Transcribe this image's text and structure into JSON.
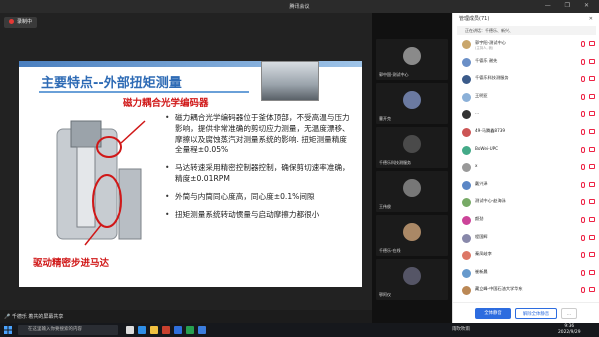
{
  "window": {
    "title": "腾讯会议",
    "controls": "— ❐ ✕"
  },
  "recording": {
    "label": "录制中"
  },
  "slide": {
    "title": "主要特点--外部扭矩测量",
    "callout_top": "磁力耦合光学编码器",
    "callout_bottom": "驱动精密步进马达",
    "bullets": [
      "磁力耦合光学编码器位于釜体顶部，不受高温与压力影响，提供非常准确的剪切应力测量，无温度漂移、摩擦以及腐蚀蒸汽对测量系统的影响. 扭矩测量精度全量程±0.05%",
      "马达转速采用精密控制器控制，确保剪切速率准确，精度±0.01RPM",
      "外筒与内筒同心度高，同心度±0.1%间隙",
      "扭矩测量系统转动惯量与启动摩擦力都很小"
    ]
  },
  "speaker_bar": {
    "text": "🎤 千德乐  着共的屏幕共享"
  },
  "gallery": [
    {
      "name": "郭中国-测试中心",
      "color": "#8a8a8a"
    },
    {
      "name": "曹开克",
      "color": "#6b7aa1"
    },
    {
      "name": "千德乐科技测服务",
      "color": "#4a4a4a"
    },
    {
      "name": "王伟俊",
      "color": "#777"
    },
    {
      "name": "千德乐-在线",
      "color": "#aa8866"
    },
    {
      "name": "鄂阿仪",
      "color": "#556"
    }
  ],
  "panel": {
    "title": "管理成员(71)",
    "notice": "正在讲话：千德乐、新兴、",
    "members": [
      {
        "name": "郭宇阳-测试中心",
        "sub": "(主持人, 我)",
        "color": "#c9a66b"
      },
      {
        "name": "千德乐 谢先",
        "sub": "",
        "color": "#6a8fc7"
      },
      {
        "name": "千德乐科技测服务",
        "sub": "",
        "color": "#3b5b8a"
      },
      {
        "name": "王明亚",
        "sub": "",
        "color": "#8bb0d8"
      },
      {
        "name": "...",
        "sub": "",
        "color": "#333"
      },
      {
        "name": "49-马腾鑫8739",
        "sub": "",
        "color": "#c55"
      },
      {
        "name": "BoWei-UPC",
        "sub": "",
        "color": "#4a8"
      },
      {
        "name": "x",
        "sub": "",
        "color": "#999"
      },
      {
        "name": "戴兴泽",
        "sub": "",
        "color": "#5b87c6"
      },
      {
        "name": "测试中心-赵海泳",
        "sub": "",
        "color": "#7a6"
      },
      {
        "name": "颜劲",
        "sub": "",
        "color": "#c49"
      },
      {
        "name": "程国辉",
        "sub": "",
        "color": "#88a"
      },
      {
        "name": "秦凤岐李",
        "sub": "",
        "color": "#d76"
      },
      {
        "name": "崔新晨",
        "sub": "",
        "color": "#69c"
      },
      {
        "name": "藏立峰-中国石油大学华东",
        "sub": "",
        "color": "#b85"
      }
    ],
    "mute_all_label": "全体静音",
    "unmute_all_label": "解除全体静音",
    "more_label": "..."
  },
  "taskbar": {
    "search_placeholder": "在这里输入你要搜索的内容",
    "weather": "雨吹吹雨",
    "time": "9:36",
    "date": "2022/9/29"
  },
  "colors": {
    "accent": "#2e6bb5",
    "callout": "#d01818",
    "danger": "#e22244",
    "primary_btn": "#2d6cdf"
  }
}
